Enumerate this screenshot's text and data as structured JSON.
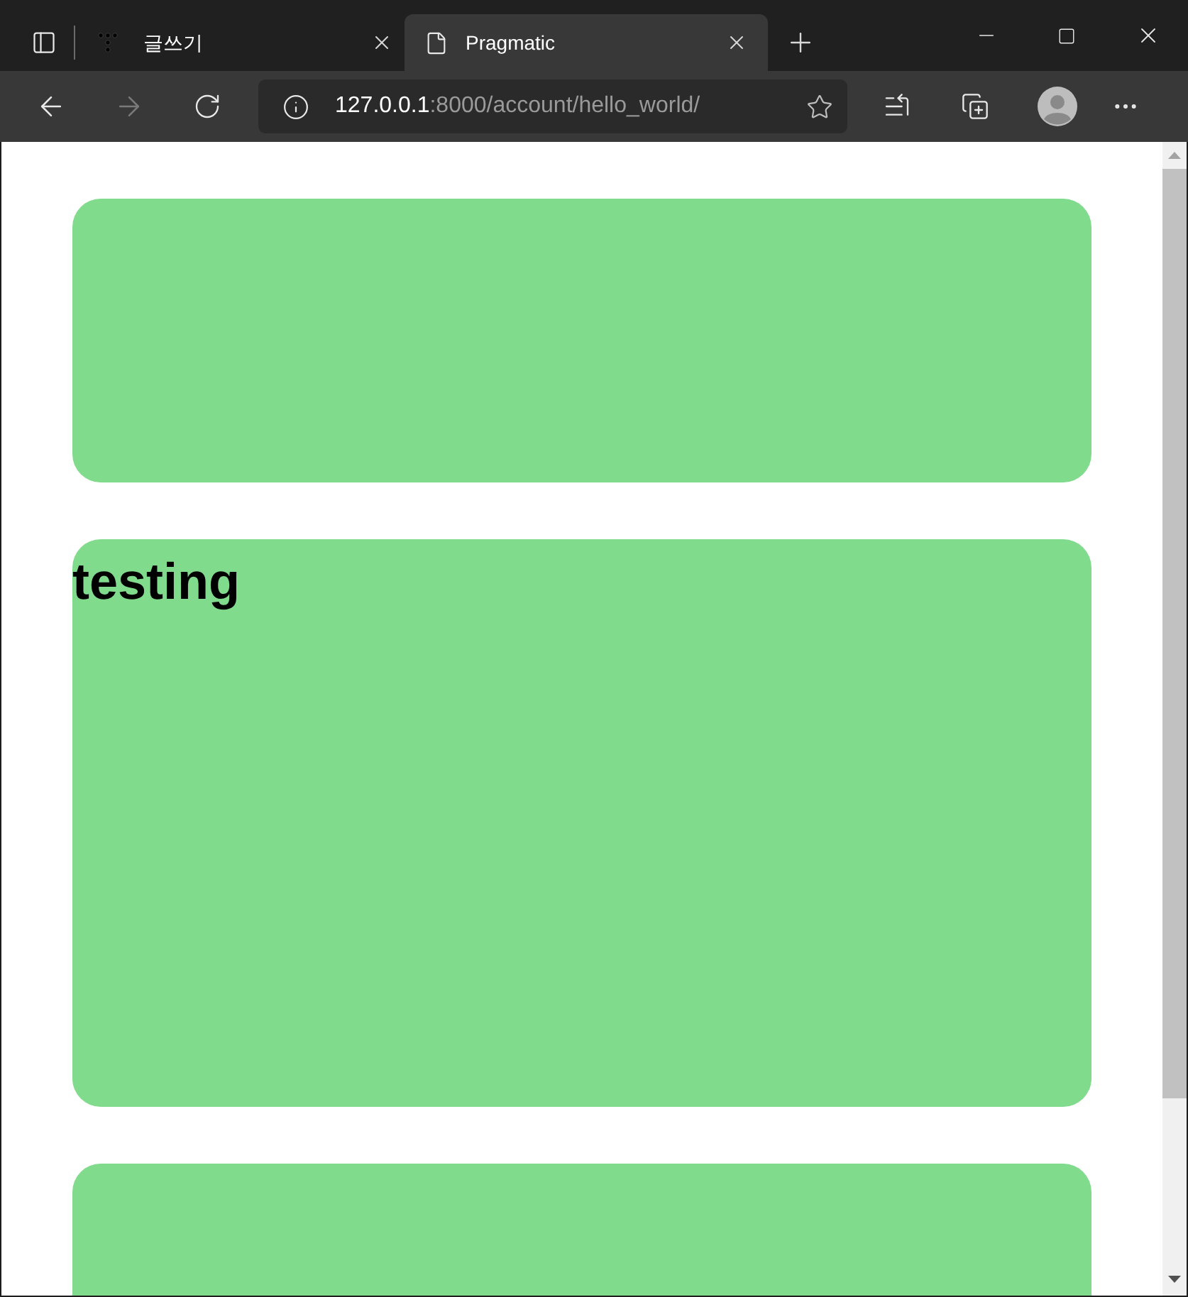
{
  "browser": {
    "tabs": [
      {
        "title": "글쓰기",
        "kind": "dots",
        "selected": false
      },
      {
        "title": "Pragmatic",
        "kind": "page",
        "selected": true
      }
    ],
    "address": {
      "host": "127.0.0.1",
      "path": ":8000/account/hello_world/"
    }
  },
  "page": {
    "cards": [
      {
        "kind": "short"
      },
      {
        "kind": "tall",
        "heading": "testing"
      },
      {
        "kind": "tall"
      }
    ]
  }
}
